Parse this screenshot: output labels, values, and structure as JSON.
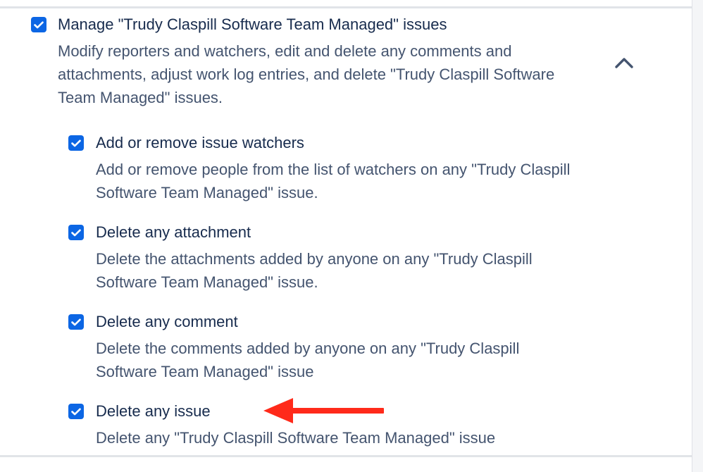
{
  "parent": {
    "title": "Manage \"Trudy Claspill Software Team Managed\" issues",
    "description": "Modify reporters and watchers, edit and delete any comments and attachments, adjust work log entries, and delete \"Trudy Claspill Software Team Managed\" issues.",
    "checked": true,
    "expand_icon": "chevron-up-icon"
  },
  "children": [
    {
      "title": "Add or remove issue watchers",
      "description": "Add or remove people from the list of watchers on any \"Trudy Claspill Software Team Managed\" issue.",
      "checked": true
    },
    {
      "title": "Delete any attachment",
      "description": "Delete the attachments added by anyone on any \"Trudy Claspill Software Team Managed\" issue.",
      "checked": true
    },
    {
      "title": "Delete any comment",
      "description": "Delete the comments added by anyone on any \"Trudy Claspill Software Team Managed\" issue",
      "checked": true
    },
    {
      "title": "Delete any issue",
      "description": "Delete any \"Trudy Claspill Software Team Managed\" issue",
      "checked": true
    }
  ],
  "annotation": {
    "icon": "red-arrow-left-icon",
    "color": "#ff2a1a"
  },
  "colors": {
    "checkbox": "#0c66e4",
    "title_text": "#172b4d",
    "description_text": "#44546f"
  }
}
